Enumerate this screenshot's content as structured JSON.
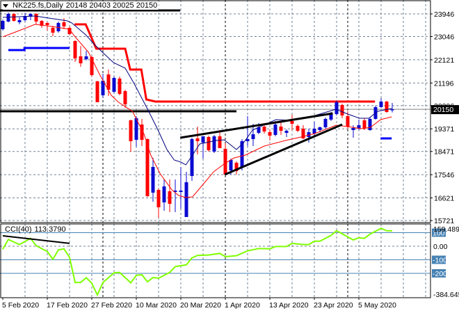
{
  "header": {
    "symbol_label": "NK225.fs,Daily",
    "ohlc": "20148 20403 20025 20150"
  },
  "chart_data": {
    "type": "candlestick",
    "title": "NK225.fs,Daily",
    "current_price": "20150",
    "y_ticks": [
      "23946",
      "23046",
      "22121",
      "21196",
      "20296",
      "19371",
      "18471",
      "17546",
      "16621",
      "15721"
    ],
    "ylim": [
      15721,
      24500
    ],
    "x_tick_labels": [
      {
        "bar": 0,
        "label": "5 Feb 2020"
      },
      {
        "bar": 8,
        "label": "17 Feb 2020"
      },
      {
        "bar": 16,
        "label": "27 Feb 2020"
      },
      {
        "bar": 24,
        "label": "10 Mar 2020"
      },
      {
        "bar": 32,
        "label": "20 Mar 2020"
      },
      {
        "bar": 40,
        "label": "1 Apr 2020"
      },
      {
        "bar": 48,
        "label": "13 Apr 2020"
      },
      {
        "bar": 56,
        "label": "23 Apr 2020"
      },
      {
        "bar": 64,
        "label": "5 May 2020"
      }
    ],
    "month_separators": [
      18,
      40,
      62
    ],
    "ohlc": [
      [
        23337,
        23725,
        23282,
        23669
      ],
      [
        23642,
        24002,
        23614,
        23946
      ],
      [
        23946,
        23974,
        23642,
        23669
      ],
      [
        23614,
        23808,
        23531,
        23697
      ],
      [
        23697,
        23974,
        23642,
        23863
      ],
      [
        23835,
        23974,
        23697,
        23946
      ],
      [
        23946,
        23974,
        23531,
        23642
      ],
      [
        23669,
        23697,
        23392,
        23475
      ],
      [
        23586,
        23614,
        23282,
        23503
      ],
      [
        23392,
        23475,
        23060,
        23199
      ],
      [
        23254,
        23642,
        23199,
        23586
      ],
      [
        23614,
        23780,
        23337,
        23448
      ],
      [
        23392,
        23448,
        23115,
        23143
      ],
      [
        22866,
        22894,
        22036,
        22174
      ],
      [
        22257,
        22672,
        21842,
        21980
      ],
      [
        22146,
        22479,
        22091,
        22257
      ],
      [
        22229,
        22285,
        21454,
        21509
      ],
      [
        21260,
        21288,
        20430,
        20430
      ],
      [
        20706,
        21565,
        20623,
        21288
      ],
      [
        21537,
        21731,
        20679,
        20928
      ],
      [
        20845,
        21454,
        20790,
        21399
      ],
      [
        21371,
        21454,
        20706,
        20762
      ],
      [
        20873,
        20928,
        20208,
        20346
      ],
      [
        19710,
        19737,
        18464,
        18879
      ],
      [
        18934,
        19876,
        18657,
        19793
      ],
      [
        19543,
        19765,
        18685,
        18934
      ],
      [
        18962,
        18990,
        16664,
        16691
      ],
      [
        16830,
        18214,
        16470,
        17854
      ],
      [
        16941,
        16996,
        15833,
        16248
      ],
      [
        16442,
        17356,
        16110,
        17079
      ],
      [
        16885,
        17356,
        16055,
        16387
      ],
      [
        16858,
        17356,
        16055,
        16913
      ],
      [
        16858,
        17854,
        16193,
        16913
      ],
      [
        15861,
        17661,
        15861,
        17245
      ],
      [
        17494,
        19017,
        17301,
        18962
      ],
      [
        18990,
        19460,
        18353,
        18879
      ],
      [
        18824,
        19073,
        18187,
        19073
      ],
      [
        19045,
        19100,
        18464,
        18519
      ],
      [
        18464,
        19128,
        18408,
        19073
      ],
      [
        19073,
        19322,
        18602,
        18602
      ],
      [
        18574,
        18796,
        17550,
        17550
      ],
      [
        17716,
        18187,
        17550,
        18131
      ],
      [
        18021,
        18076,
        17550,
        17688
      ],
      [
        17854,
        18962,
        17716,
        18879
      ],
      [
        18879,
        19876,
        18685,
        18962
      ],
      [
        18962,
        19571,
        18685,
        19156
      ],
      [
        19211,
        19599,
        19156,
        19433
      ],
      [
        19460,
        19516,
        19184,
        19267
      ],
      [
        19239,
        19350,
        18907,
        19100
      ],
      [
        19128,
        19682,
        19073,
        19543
      ],
      [
        19460,
        19627,
        19128,
        19294
      ],
      [
        19211,
        19350,
        19045,
        19294
      ],
      [
        19682,
        19931,
        19322,
        19571
      ],
      [
        19488,
        19543,
        19239,
        19294
      ],
      [
        19377,
        19516,
        18962,
        18990
      ],
      [
        19045,
        19377,
        18824,
        19239
      ],
      [
        19184,
        19654,
        19100,
        19377
      ],
      [
        19322,
        19460,
        19239,
        19433
      ],
      [
        19433,
        19820,
        19377,
        19765
      ],
      [
        19737,
        20042,
        19682,
        19987
      ],
      [
        19959,
        20485,
        19903,
        20430
      ],
      [
        20319,
        20374,
        19793,
        19903
      ],
      [
        19876,
        20070,
        19377,
        19460
      ],
      [
        19322,
        19516,
        19017,
        19405
      ],
      [
        19377,
        19737,
        19322,
        19516
      ],
      [
        19710,
        19793,
        19322,
        19377
      ],
      [
        19322,
        19820,
        19294,
        19765
      ],
      [
        19765,
        20291,
        19737,
        20236
      ],
      [
        20236,
        20596,
        20208,
        20457
      ],
      [
        20457,
        20485,
        20014,
        20042
      ],
      [
        20148,
        20403,
        20025,
        20150
      ]
    ],
    "ma_blue": [
      [
        0,
        23808
      ],
      [
        5.8,
        23863
      ],
      [
        11.6,
        23669
      ],
      [
        12.4,
        23586
      ],
      [
        14.9,
        23115
      ],
      [
        16.6,
        22700
      ],
      [
        17.9,
        22423
      ],
      [
        19.9,
        22008
      ],
      [
        22,
        21786
      ],
      [
        23.6,
        21177
      ],
      [
        26.1,
        20125
      ],
      [
        27.9,
        19322
      ],
      [
        29.5,
        18547
      ],
      [
        30.8,
        18131
      ],
      [
        32,
        18048
      ],
      [
        32.9,
        17937
      ],
      [
        34.1,
        18325
      ],
      [
        35.4,
        18768
      ],
      [
        36.6,
        18824
      ],
      [
        38.3,
        18907
      ],
      [
        39.8,
        18934
      ],
      [
        42,
        18547
      ],
      [
        43.3,
        18824
      ],
      [
        44.9,
        19322
      ],
      [
        49.1,
        19737
      ],
      [
        52,
        19710
      ],
      [
        54.5,
        19793
      ],
      [
        57.4,
        19987
      ],
      [
        59.9,
        20153
      ],
      [
        62,
        19959
      ],
      [
        64.1,
        19793
      ],
      [
        65.8,
        19793
      ],
      [
        67.4,
        20070
      ],
      [
        69.9,
        20180
      ]
    ],
    "ma_red": [
      [
        0,
        23032
      ],
      [
        3.6,
        23337
      ],
      [
        5.8,
        23531
      ],
      [
        7.9,
        23475
      ],
      [
        12,
        23337
      ],
      [
        12.9,
        23060
      ],
      [
        15.4,
        22423
      ],
      [
        17.4,
        21537
      ],
      [
        19.5,
        20706
      ],
      [
        20.8,
        20430
      ],
      [
        23.3,
        20070
      ],
      [
        25.4,
        19156
      ],
      [
        26.6,
        18325
      ],
      [
        28.3,
        17577
      ],
      [
        30.4,
        16941
      ],
      [
        31.6,
        16719
      ],
      [
        32.9,
        16636
      ],
      [
        34.1,
        16664
      ],
      [
        35.8,
        17107
      ],
      [
        37.9,
        17661
      ],
      [
        39.9,
        17993
      ],
      [
        41.6,
        18214
      ],
      [
        43.6,
        18325
      ],
      [
        47,
        18685
      ],
      [
        50.8,
        18907
      ],
      [
        53.6,
        19045
      ],
      [
        56.1,
        19184
      ],
      [
        59.9,
        19516
      ],
      [
        62,
        19460
      ],
      [
        64.5,
        19377
      ],
      [
        66.1,
        19433
      ],
      [
        67.9,
        19737
      ],
      [
        69.9,
        19848
      ]
    ],
    "red_step_line": [
      [
        12.9,
        23531
      ],
      [
        14.9,
        23531
      ],
      [
        16.8,
        22562
      ],
      [
        22,
        22562
      ],
      [
        22.9,
        21731
      ],
      [
        24.9,
        21731
      ],
      [
        25.8,
        20540
      ],
      [
        27.4,
        20457
      ],
      [
        66.9,
        20457
      ]
    ],
    "blue_step_lines": [
      [
        [
          1,
          22506
        ],
        [
          3.9,
          22506
        ],
        [
          3.9,
          22589
        ],
        [
          12,
          22589
        ]
      ],
      [
        [
          67.9,
          18990
        ],
        [
          69.9,
          18990
        ]
      ]
    ],
    "horizontal_lines": [
      {
        "price": 24085,
        "from_bar": -0.5,
        "to_bar": 31.9
      },
      {
        "price": 20070,
        "from_bar": -0.5,
        "to_bar": 42
      }
    ],
    "trend_lines": [
      [
        [
          31.9,
          19017
        ],
        [
          59.3,
          19987
        ]
      ],
      [
        [
          39.9,
          17550
        ],
        [
          61,
          19543
        ]
      ]
    ],
    "cci": {
      "name": "CCI(40)",
      "current": "113.3790",
      "max_label": "159.4893",
      "min_label": "-384.6450",
      "zero_label": "0.00",
      "levels": [
        {
          "value": 100,
          "label": "100"
        },
        {
          "value": -100,
          "label": "-100"
        },
        {
          "value": -200,
          "label": "-200"
        }
      ],
      "values": [
        [
          0,
          -22
        ],
        [
          1,
          50
        ],
        [
          3,
          12
        ],
        [
          5,
          58
        ],
        [
          6,
          4
        ],
        [
          8,
          -39
        ],
        [
          9,
          -96
        ],
        [
          10,
          -27
        ],
        [
          11,
          -19
        ],
        [
          12,
          -82
        ],
        [
          13,
          -267
        ],
        [
          14,
          -267
        ],
        [
          15,
          -232
        ],
        [
          16,
          -273
        ],
        [
          17,
          -359
        ],
        [
          18,
          -267
        ],
        [
          20,
          -196
        ],
        [
          21,
          -193
        ],
        [
          23,
          -270
        ],
        [
          24,
          -215
        ],
        [
          25,
          -210
        ],
        [
          26,
          -262
        ],
        [
          27,
          -231
        ],
        [
          28,
          -236
        ],
        [
          30,
          -193
        ],
        [
          31,
          -150
        ],
        [
          33,
          -137
        ],
        [
          34,
          -86
        ],
        [
          35,
          -68
        ],
        [
          37,
          -65
        ],
        [
          39,
          -53
        ],
        [
          40,
          -77
        ],
        [
          42,
          -70
        ],
        [
          44,
          -34
        ],
        [
          46,
          -17
        ],
        [
          48,
          -19
        ],
        [
          49,
          -2
        ],
        [
          51,
          -2
        ],
        [
          52,
          21
        ],
        [
          54,
          12
        ],
        [
          55,
          12
        ],
        [
          56,
          37
        ],
        [
          57,
          37
        ],
        [
          59,
          80
        ],
        [
          60,
          114
        ],
        [
          61,
          92
        ],
        [
          63,
          46
        ],
        [
          64,
          63
        ],
        [
          65,
          58
        ],
        [
          66,
          89
        ],
        [
          68,
          132
        ],
        [
          69,
          114
        ],
        [
          70,
          113.379
        ]
      ],
      "trend_line": [
        [
          0,
          77
        ],
        [
          12,
          21
        ]
      ]
    },
    "colors": {
      "bull": "#0a0ad2",
      "bear": "#ff0000",
      "ma_blue": "#000080",
      "ma_red": "#ff0000",
      "step_red": "#ff0000",
      "step_blue": "#0000ff",
      "cci_line": "#7fff00",
      "cci_level": "#4682b4",
      "grid": "#708090",
      "price_line": "#808080"
    }
  }
}
